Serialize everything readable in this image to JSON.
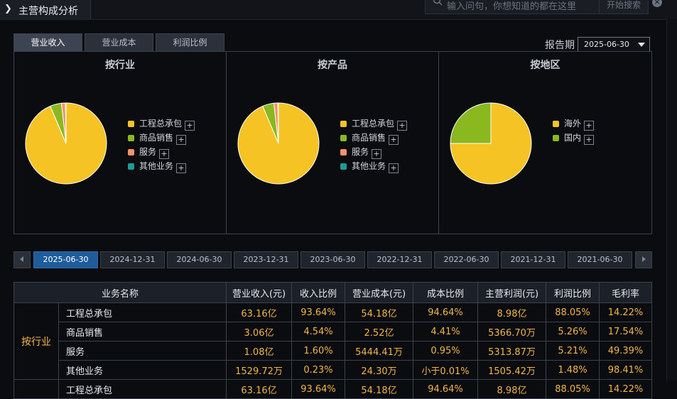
{
  "window": {
    "title": "主营构成分析",
    "search_placeholder": "输入问句，你想知道的都在这里",
    "search_button": "开始搜索"
  },
  "metric_tabs": [
    "营业收入",
    "营业成本",
    "利润比例"
  ],
  "active_metric_tab": 0,
  "report": {
    "label": "报告期",
    "value": "2025-06-30"
  },
  "colors": {
    "gold": "#f6c324",
    "green": "#8ab81f",
    "salmon": "#f5936a",
    "teal": "#1e9c98",
    "accent_blue": "#1f5c9a",
    "value_text": "#f0b64a"
  },
  "charts_meta": {
    "panels": [
      {
        "title": "按行业",
        "legend": [
          "工程总承包",
          "商品销售",
          "服务",
          "其他业务"
        ]
      },
      {
        "title": "按产品",
        "legend": [
          "工程总承包",
          "商品销售",
          "服务",
          "其他业务"
        ]
      },
      {
        "title": "按地区",
        "legend": [
          "海外",
          "国内"
        ]
      }
    ]
  },
  "chart_data": [
    {
      "type": "pie",
      "title": "按行业",
      "labels": [
        "工程总承包",
        "商品销售",
        "服务",
        "其他业务"
      ],
      "values": [
        93.64,
        4.54,
        1.6,
        0.23
      ],
      "colors": [
        "#f6c324",
        "#8ab81f",
        "#f5936a",
        "#1e9c98"
      ]
    },
    {
      "type": "pie",
      "title": "按产品",
      "labels": [
        "工程总承包",
        "商品销售",
        "服务",
        "其他业务"
      ],
      "values": [
        93.64,
        4.54,
        1.6,
        0.23
      ],
      "colors": [
        "#f6c324",
        "#8ab81f",
        "#f5936a",
        "#1e9c98"
      ]
    },
    {
      "type": "pie",
      "title": "按地区",
      "labels": [
        "海外",
        "国内"
      ],
      "values": [
        75,
        25
      ],
      "colors": [
        "#f6c324",
        "#8ab81f"
      ]
    }
  ],
  "dates": [
    "2025-06-30",
    "2024-12-31",
    "2024-06-30",
    "2023-12-31",
    "2023-06-30",
    "2022-12-31",
    "2022-06-30",
    "2021-12-31",
    "2021-06-30"
  ],
  "active_date": 0,
  "table": {
    "headers": [
      "业务名称",
      "营业收入(元)",
      "收入比例",
      "营业成本(元)",
      "成本比例",
      "主营利润(元)",
      "利润比例",
      "毛利率"
    ],
    "group1_label": "按行业",
    "rows": [
      [
        "工程总承包",
        "63.16亿",
        "93.64%",
        "54.18亿",
        "94.64%",
        "8.98亿",
        "88.05%",
        "14.22%"
      ],
      [
        "商品销售",
        "3.06亿",
        "4.54%",
        "2.52亿",
        "4.41%",
        "5366.70万",
        "5.26%",
        "17.54%"
      ],
      [
        "服务",
        "1.08亿",
        "1.60%",
        "5444.41万",
        "0.95%",
        "5313.87万",
        "5.21%",
        "49.39%"
      ],
      [
        "其他业务",
        "1529.72万",
        "0.23%",
        "24.30万",
        "小于0.01%",
        "1505.42万",
        "1.48%",
        "98.41%"
      ],
      [
        "工程总承包",
        "63.16亿",
        "93.64%",
        "54.18亿",
        "94.64%",
        "8.98亿",
        "88.05%",
        "14.22%"
      ]
    ]
  }
}
